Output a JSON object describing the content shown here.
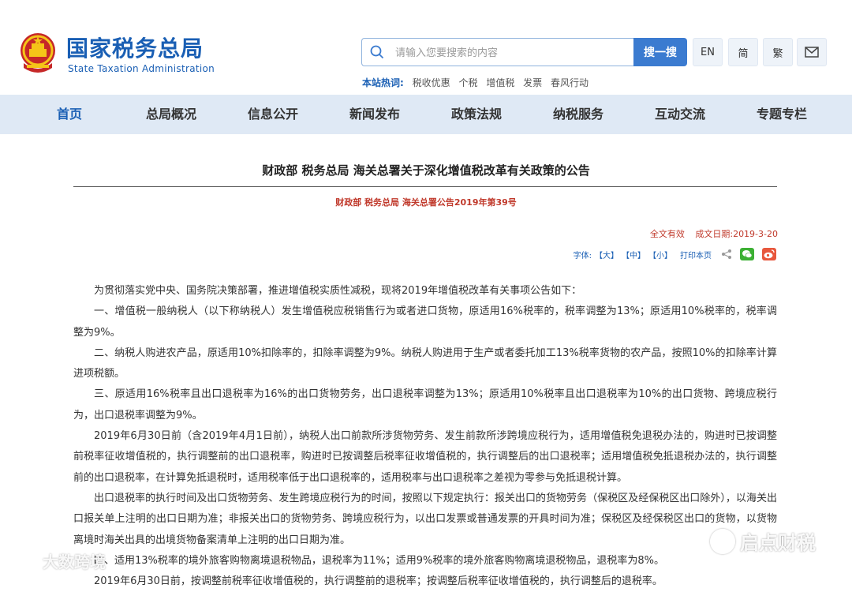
{
  "header": {
    "brand_cn": "国家税务总局",
    "brand_en": "State Taxation Administration",
    "search_placeholder": "请输入您要搜索的内容",
    "search_button": "搜一搜",
    "lang_en": "EN",
    "lang_simplified": "简",
    "lang_traditional": "繁",
    "hot_label": "本站热词:",
    "hot_words": [
      "税收优惠",
      "个税",
      "增值税",
      "发票",
      "春风行动"
    ]
  },
  "nav": {
    "items": [
      "首页",
      "总局概况",
      "信息公开",
      "新闻发布",
      "政策法规",
      "纳税服务",
      "互动交流",
      "专题专栏"
    ]
  },
  "article": {
    "title": "财政部 税务总局 海关总署关于深化增值税改革有关政策的公告",
    "doc_number": "财政部 税务总局 海关总署公告2019年第39号",
    "validity": "全文有效",
    "date": "成文日期:2019-3-20",
    "font_label": "字体:",
    "font_large": "【大】",
    "font_medium": "【中】",
    "font_small": "【小】",
    "print": "打印本页",
    "paragraphs": [
      "为贯彻落实党中央、国务院决策部署，推进增值税实质性减税，现将2019年增值税改革有关事项公告如下：",
      "一、增值税一般纳税人（以下称纳税人）发生增值税应税销售行为或者进口货物，原适用16%税率的，税率调整为13%；原适用10%税率的，税率调整为9%。",
      "二、纳税人购进农产品，原适用10%扣除率的，扣除率调整为9%。纳税人购进用于生产或者委托加工13%税率货物的农产品，按照10%的扣除率计算进项税额。",
      "三、原适用16%税率且出口退税率为16%的出口货物劳务，出口退税率调整为13%；原适用10%税率且出口退税率为10%的出口货物、跨境应税行为，出口退税率调整为9%。",
      "2019年6月30日前（含2019年4月1日前），纳税人出口前款所涉货物劳务、发生前款所涉跨境应税行为，适用增值税免退税办法的，购进时已按调整前税率征收增值税的，执行调整前的出口退税率，购进时已按调整后税率征收增值税的，执行调整后的出口退税率；适用增值税免抵退税办法的，执行调整前的出口退税率，在计算免抵退税时，适用税率低于出口退税率的，适用税率与出口退税率之差视为零参与免抵退税计算。",
      "出口退税率的执行时间及出口货物劳务、发生跨境应税行为的时间，按照以下规定执行：报关出口的货物劳务（保税区及经保税区出口除外），以海关出口报关单上注明的出口日期为准；非报关出口的货物劳务、跨境应税行为，以出口发票或普通发票的开具时间为准；保税区及经保税区出口的货物，以货物离境时海关出具的出境货物备案清单上注明的出口日期为准。",
      "四、适用13%税率的境外旅客购物离境退税物品，退税率为11%；适用9%税率的境外旅客购物离境退税物品，退税率为8%。",
      "2019年6月30日前，按调整前税率征收增值税的，执行调整前的退税率；按调整后税率征收增值税的，执行调整后的退税率。"
    ]
  },
  "watermarks": {
    "left": "大数跨境",
    "right": "启点财税"
  },
  "colors": {
    "brand_blue": "#1a5fb4",
    "nav_bg": "#dfe9f5",
    "accent_red": "#c0392b",
    "search_button": "#3b7bd0"
  }
}
